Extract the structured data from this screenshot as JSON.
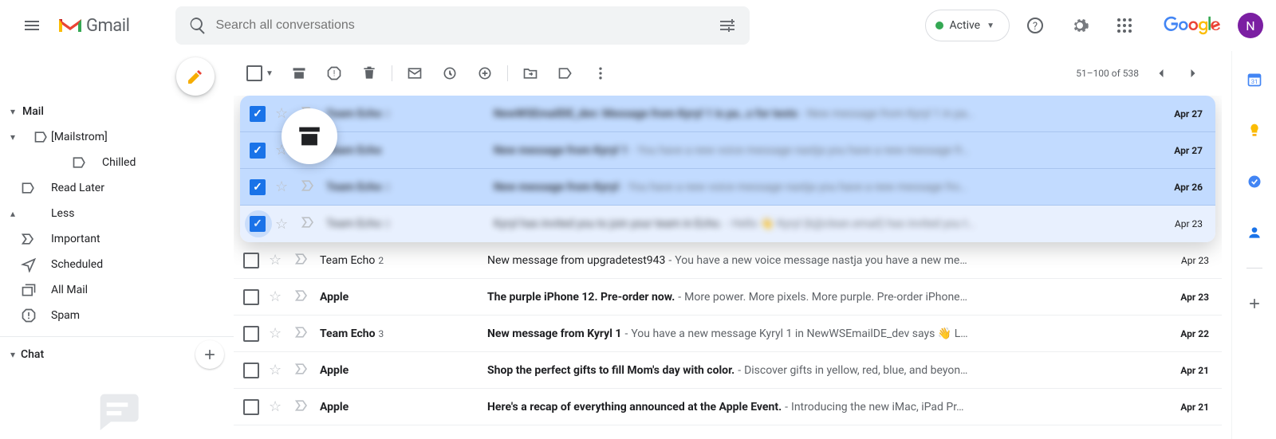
{
  "header": {
    "product_name": "Gmail",
    "search_placeholder": "Search all conversations",
    "status_label": "Active",
    "avatar_initial": "N"
  },
  "sidebar": {
    "sections": {
      "mail_label": "Mail",
      "chat_label": "Chat"
    },
    "items": [
      {
        "label": "[Mailstrom]",
        "indent": 1,
        "caret": true,
        "icon": null
      },
      {
        "label": "Chilled",
        "indent": 2,
        "caret": false,
        "icon": "label"
      },
      {
        "label": "Read Later",
        "indent": 0,
        "caret": false,
        "icon": "label"
      },
      {
        "label": "Less",
        "indent": 0,
        "caret": true,
        "caret_dir": "up",
        "icon": null
      },
      {
        "label": "Important",
        "indent": 0,
        "caret": false,
        "icon": "important"
      },
      {
        "label": "Scheduled",
        "indent": 0,
        "caret": false,
        "icon": "scheduled"
      },
      {
        "label": "All Mail",
        "indent": 0,
        "caret": false,
        "icon": "stack"
      },
      {
        "label": "Spam",
        "indent": 0,
        "caret": false,
        "icon": "spam"
      }
    ]
  },
  "toolbar": {
    "paging": "51–100 of 538"
  },
  "rows_selected": [
    {
      "sender": "Team Echo",
      "count": "2",
      "subject": "NewWSEmailDE_dev: Message from Kyryl 1 is pa…s for tests",
      "snippet": "New message from Kyryl 1 in pa…",
      "date": "Apr 27",
      "unread": true,
      "checked": true
    },
    {
      "sender": "Team Echo",
      "count": "",
      "subject": "New message from Kyryl 1",
      "snippet": "You have a new voice message nastja you have a new message fr…",
      "date": "Apr 27",
      "unread": true,
      "checked": true
    },
    {
      "sender": "Team Echo",
      "count": "2",
      "subject": "New message from Kyryl",
      "snippet": "You have a new voice message nastja you have a new message fro…",
      "date": "Apr 26",
      "unread": true,
      "checked": true
    },
    {
      "sender": "Team Echo",
      "count": "2",
      "subject": "Kyryl has invited you to join your team in Echo.",
      "snippet": "Hello 👋 Kyryl (k@clean.email) has invited you t…",
      "date": "Apr 23",
      "unread": false,
      "checked": true,
      "just_checked": true
    }
  ],
  "rows_rest": [
    {
      "sender": "Team Echo",
      "count": "2",
      "subject": "New message from upgradetest943",
      "snippet": "You have a new voice message nastja you have a new me…",
      "date": "Apr 23",
      "unread": false
    },
    {
      "sender": "Apple",
      "count": "",
      "subject": "The purple iPhone 12. Pre-order now.",
      "snippet": "More power. More pixels. More purple. Pre-order iPhone…",
      "date": "Apr 23",
      "unread": true
    },
    {
      "sender": "Team Echo",
      "count": "3",
      "subject": "New message from Kyryl 1",
      "snippet": "You have a new message Kyryl 1 in NewWSEmailDE_dev says 👋 L…",
      "date": "Apr 22",
      "unread": true
    },
    {
      "sender": "Apple",
      "count": "",
      "subject": "Shop the perfect gifts to fill Mom's day with color.",
      "snippet": "Discover gifts in yellow, red, blue, and beyon…",
      "date": "Apr 21",
      "unread": true
    },
    {
      "sender": "Apple",
      "count": "",
      "subject": "Here's a recap of everything announced at the Apple Event.",
      "snippet": "Introducing the new iMac, iPad Pr…",
      "date": "Apr 21",
      "unread": true
    }
  ]
}
